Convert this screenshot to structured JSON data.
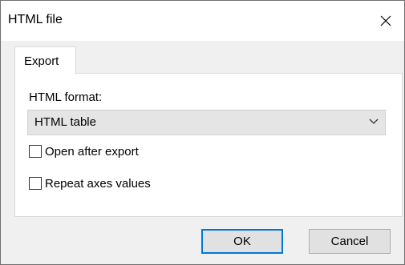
{
  "window": {
    "title": "HTML file"
  },
  "titlebar": {
    "close_icon": "close-icon"
  },
  "tabs": [
    {
      "label": "Export",
      "active": true
    }
  ],
  "export": {
    "format_label": "HTML format:",
    "format_value": "HTML table",
    "open_after_export": {
      "label": "Open after export",
      "checked": false
    },
    "repeat_axes_values": {
      "label": "Repeat axes values",
      "checked": false
    }
  },
  "buttons": {
    "ok": "OK",
    "cancel": "Cancel"
  },
  "colors": {
    "focus_border": "#0078d7",
    "dialog_bg": "#f0f0f0"
  }
}
